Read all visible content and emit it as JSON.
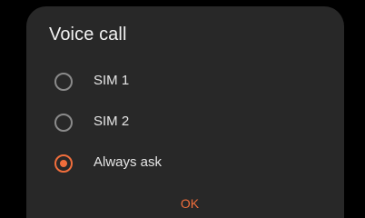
{
  "dialog": {
    "title": "Voice call",
    "options": [
      {
        "label": "SIM 1",
        "selected": false
      },
      {
        "label": "SIM 2",
        "selected": false
      },
      {
        "label": "Always ask",
        "selected": true
      }
    ],
    "ok_label": "OK"
  },
  "colors": {
    "background": "#000000",
    "dialog": "#282828",
    "accent": "#f06e3c",
    "radio_unchecked": "#8a8a8a",
    "text": "#e6e6e6"
  }
}
